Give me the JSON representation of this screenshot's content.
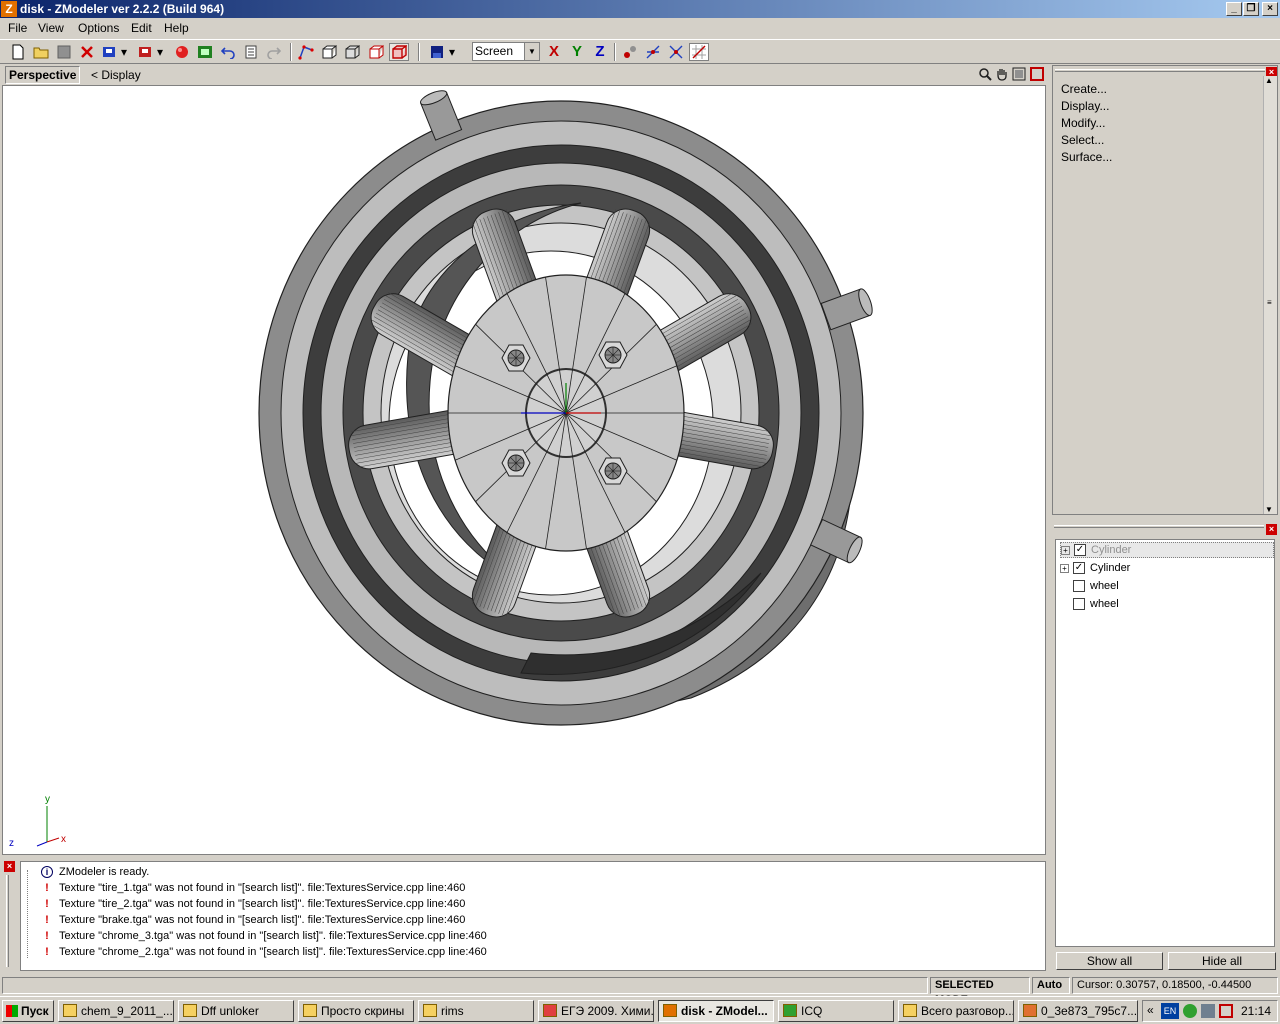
{
  "window": {
    "title": "disk - ZModeler ver 2.2.2 (Build 964)",
    "app_icon": "Z"
  },
  "menu": [
    "File",
    "View",
    "Options",
    "Edit",
    "Help"
  ],
  "toolbar": {
    "coord_space": "Screen",
    "axes": [
      "X",
      "Y",
      "Z"
    ],
    "axis_colors": [
      "#c00000",
      "#008000",
      "#0000c0"
    ]
  },
  "viewport": {
    "name": "Perspective",
    "display_menu": "<  Display",
    "axis_labels": {
      "x": "x",
      "y": "y",
      "z": "z"
    }
  },
  "command_panel": {
    "items": [
      "Create...",
      "Display...",
      "Modify...",
      "Select...",
      "Surface..."
    ]
  },
  "objects": {
    "items": [
      {
        "label": "Cylinder",
        "checked": true,
        "expandable": true,
        "selected": true
      },
      {
        "label": "Cylinder",
        "checked": true,
        "expandable": true,
        "selected": false
      },
      {
        "label": "wheel",
        "checked": false,
        "expandable": false,
        "selected": false
      },
      {
        "label": "wheel",
        "checked": false,
        "expandable": false,
        "selected": false
      }
    ],
    "show_all_label": "Show all",
    "hide_all_label": "Hide all"
  },
  "log": [
    {
      "type": "info",
      "text": "ZModeler is ready."
    },
    {
      "type": "error",
      "text": "Texture \"tire_1.tga\" was not found in \"[search list]\". file:TexturesService.cpp line:460"
    },
    {
      "type": "error",
      "text": "Texture \"tire_2.tga\" was not found in \"[search list]\". file:TexturesService.cpp line:460"
    },
    {
      "type": "error",
      "text": "Texture \"brake.tga\" was not found in \"[search list]\". file:TexturesService.cpp line:460"
    },
    {
      "type": "error",
      "text": "Texture \"chrome_3.tga\" was not found in \"[search list]\". file:TexturesService.cpp line:460"
    },
    {
      "type": "error",
      "text": "Texture \"chrome_2.tga\" was not found in \"[search list]\". file:TexturesService.cpp line:460"
    }
  ],
  "status": {
    "mode": "SELECTED MODE",
    "snap": "Auto",
    "cursor": "Cursor: 0.30757, 0.18500, -0.44500"
  },
  "taskbar": {
    "start_label": "Пуск",
    "tasks": [
      {
        "label": "chem_9_2011_...",
        "active": false
      },
      {
        "label": "Dff unloker",
        "active": false
      },
      {
        "label": "Просто скрины",
        "active": false
      },
      {
        "label": "rims",
        "active": false
      },
      {
        "label": "ЕГЭ 2009. Хими...",
        "active": false
      },
      {
        "label": "disk - ZModel...",
        "active": true
      },
      {
        "label": "ICQ",
        "active": false
      },
      {
        "label": "Всего разговор...",
        "active": false
      },
      {
        "label": "0_3e873_795c7...",
        "active": false
      }
    ],
    "lang": "EN",
    "clock": "21:14"
  }
}
